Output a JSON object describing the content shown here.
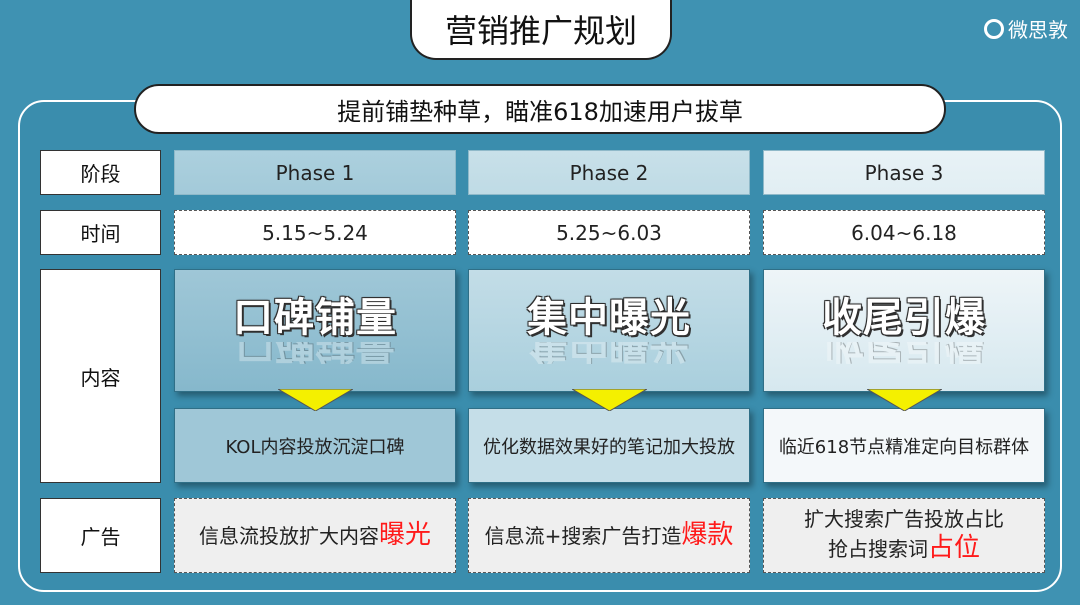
{
  "title": "营销推广规划",
  "brand": "微思敦",
  "subtitle": "提前铺垫种草，瞄准618加速用户拔草",
  "row_labels": {
    "stage": "阶段",
    "time": "时间",
    "content": "内容",
    "ad": "广告"
  },
  "phases": [
    {
      "name": "Phase 1",
      "time": "5.15~5.24",
      "theme": "口碑铺量",
      "description": "KOL内容投放沉淀口碑",
      "ad_lines": [
        "信息流投放扩大内容"
      ],
      "ad_highlight": "曝光"
    },
    {
      "name": "Phase 2",
      "time": "5.25~6.03",
      "theme": "集中曝光",
      "description": "优化数据效果好的笔记加大投放",
      "ad_lines": [
        "信息流+搜索广告打造"
      ],
      "ad_highlight": "爆款"
    },
    {
      "name": "Phase 3",
      "time": "6.04~6.18",
      "theme": "收尾引爆",
      "description": "临近618节点精准定向目标群体",
      "ad_lines": [
        "扩大搜索广告投放占比",
        "抢占搜索词"
      ],
      "ad_highlight": "占位"
    }
  ],
  "colors": {
    "background": "#3f92b2",
    "highlight": "#ff1a1a",
    "arrow": "#f4f000"
  }
}
